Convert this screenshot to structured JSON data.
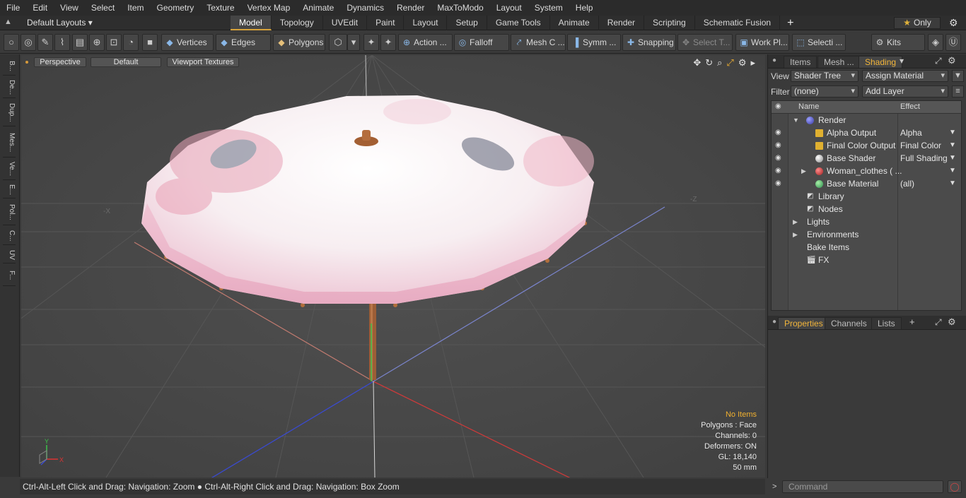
{
  "menu": [
    "File",
    "Edit",
    "View",
    "Select",
    "Item",
    "Geometry",
    "Texture",
    "Vertex Map",
    "Animate",
    "Dynamics",
    "Render",
    "MaxToModo",
    "Layout",
    "System",
    "Help"
  ],
  "layouts_label": "Default Layouts ▾",
  "tabs": [
    "Model",
    "Topology",
    "UVEdit",
    "Paint",
    "Layout",
    "Setup",
    "Game Tools",
    "Animate",
    "Render",
    "Scripting",
    "Schematic Fusion"
  ],
  "only_label": "Only",
  "toolbar": {
    "vertices": "Vertices",
    "edges": "Edges",
    "polygons": "Polygons",
    "action": "Action ...",
    "falloff": "Falloff",
    "mesh": "Mesh C ...",
    "symm": "Symm ...",
    "snapping": "Snapping",
    "select_t": "Select T...",
    "work_pl": "Work Pl...",
    "selecti": "Selecti ...",
    "kits": "Kits"
  },
  "left_tabs": [
    "B...",
    "De...",
    "Dup...",
    "Mes...",
    "Ve...",
    "E...",
    "Pol...",
    "C...",
    "UV",
    "F..."
  ],
  "viewport": {
    "perspective": "Perspective",
    "default": "Default",
    "textures": "Viewport Textures",
    "hud": {
      "items": "No Items",
      "polygons": "Polygons : Face",
      "channels": "Channels: 0",
      "deformers": "Deformers: ON",
      "gl": "GL: 18,140",
      "size": "50 mm"
    },
    "axis_labels": {
      "neg_x": "-X",
      "neg_z": "-Z",
      "y": "Y",
      "x": "X"
    }
  },
  "panel": {
    "tabs": [
      "Items",
      "Mesh ...",
      "Shading"
    ],
    "view_label": "View",
    "view_value": "Shader Tree",
    "assign": "Assign Material",
    "filter_label": "Filter",
    "filter_value": "(none)",
    "add_layer": "Add Layer",
    "col_name": "Name",
    "col_effect": "Effect",
    "tree": [
      {
        "label": "Render",
        "effect": ""
      },
      {
        "label": "Alpha Output",
        "effect": "Alpha"
      },
      {
        "label": "Final Color Output",
        "effect": "Final Color"
      },
      {
        "label": "Base Shader",
        "effect": "Full Shading"
      },
      {
        "label": "Woman_clothes ( ...",
        "effect": ""
      },
      {
        "label": "Base Material",
        "effect": "(all)"
      },
      {
        "label": "Library",
        "effect": ""
      },
      {
        "label": "Nodes",
        "effect": ""
      },
      {
        "label": "Lights",
        "effect": ""
      },
      {
        "label": "Environments",
        "effect": ""
      },
      {
        "label": "Bake Items",
        "effect": ""
      },
      {
        "label": "FX",
        "effect": ""
      }
    ],
    "prop_tabs": [
      "Properties",
      "Channels",
      "Lists"
    ],
    "command_placeholder": "Command"
  },
  "status": "Ctrl-Alt-Left Click and Drag: Navigation: Zoom ● Ctrl-Alt-Right Click and Drag: Navigation: Box Zoom",
  "colors": {
    "accent": "#f2b53a",
    "umbrella": "#f3c9d5",
    "handle": "#a0623a"
  }
}
